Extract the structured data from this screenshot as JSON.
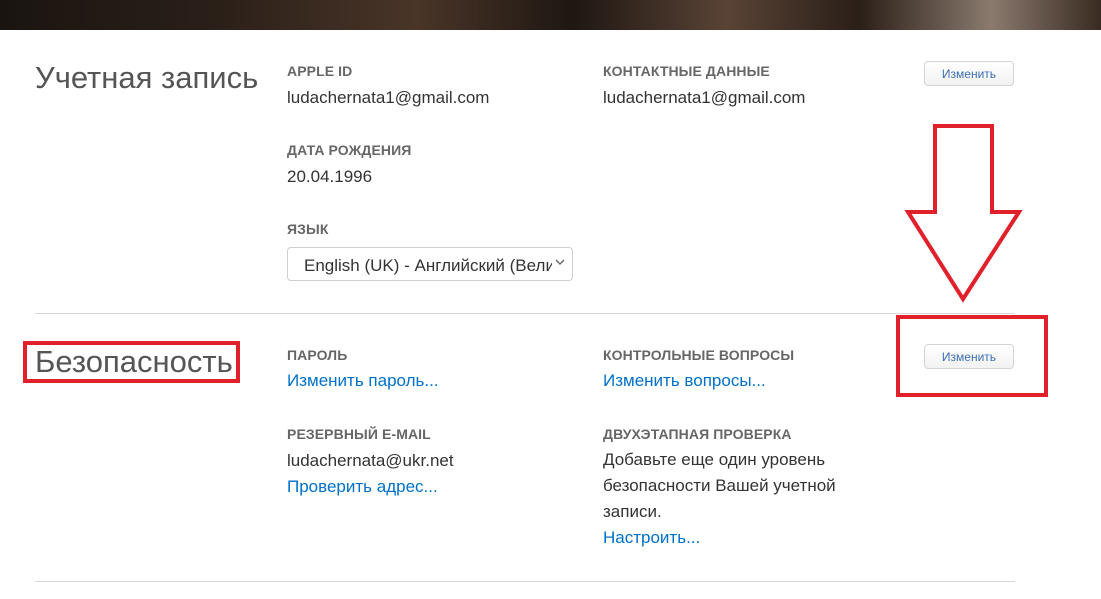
{
  "account": {
    "title": "Учетная запись",
    "apple_id_label": "APPLE ID",
    "apple_id_value": "ludachernata1@gmail.com",
    "contact_label": "КОНТАКТНЫЕ ДАННЫЕ",
    "contact_value": "ludachernata1@gmail.com",
    "birthdate_label": "ДАТА РОЖДЕНИЯ",
    "birthdate_value": "20.04.1996",
    "language_label": "ЯЗЫК",
    "language_value": "English (UK) - Английский (Великобритания)",
    "edit_label": "Изменить"
  },
  "security": {
    "title": "Безопасность",
    "password_label": "ПАРОЛЬ",
    "password_link": "Изменить пароль...",
    "questions_label": "КОНТРОЛЬНЫЕ ВОПРОСЫ",
    "questions_link": "Изменить вопросы...",
    "backup_email_label": "РЕЗЕРВНЫЙ E-MAIL",
    "backup_email_value": "ludachernata@ukr.net",
    "verify_link": "Проверить адрес...",
    "two_step_label": "ДВУХЭТАПНАЯ ПРОВЕРКА",
    "two_step_text": "Добавьте еще один уровень безопасности Вашей учетной записи.",
    "setup_link": "Настроить...",
    "edit_label": "Изменить"
  },
  "annotations": {
    "highlight_color": "#e0202a",
    "arrow_icon": "down-arrow-icon"
  },
  "colors": {
    "link": "#0070c9",
    "button_text": "#3a6fb0"
  }
}
